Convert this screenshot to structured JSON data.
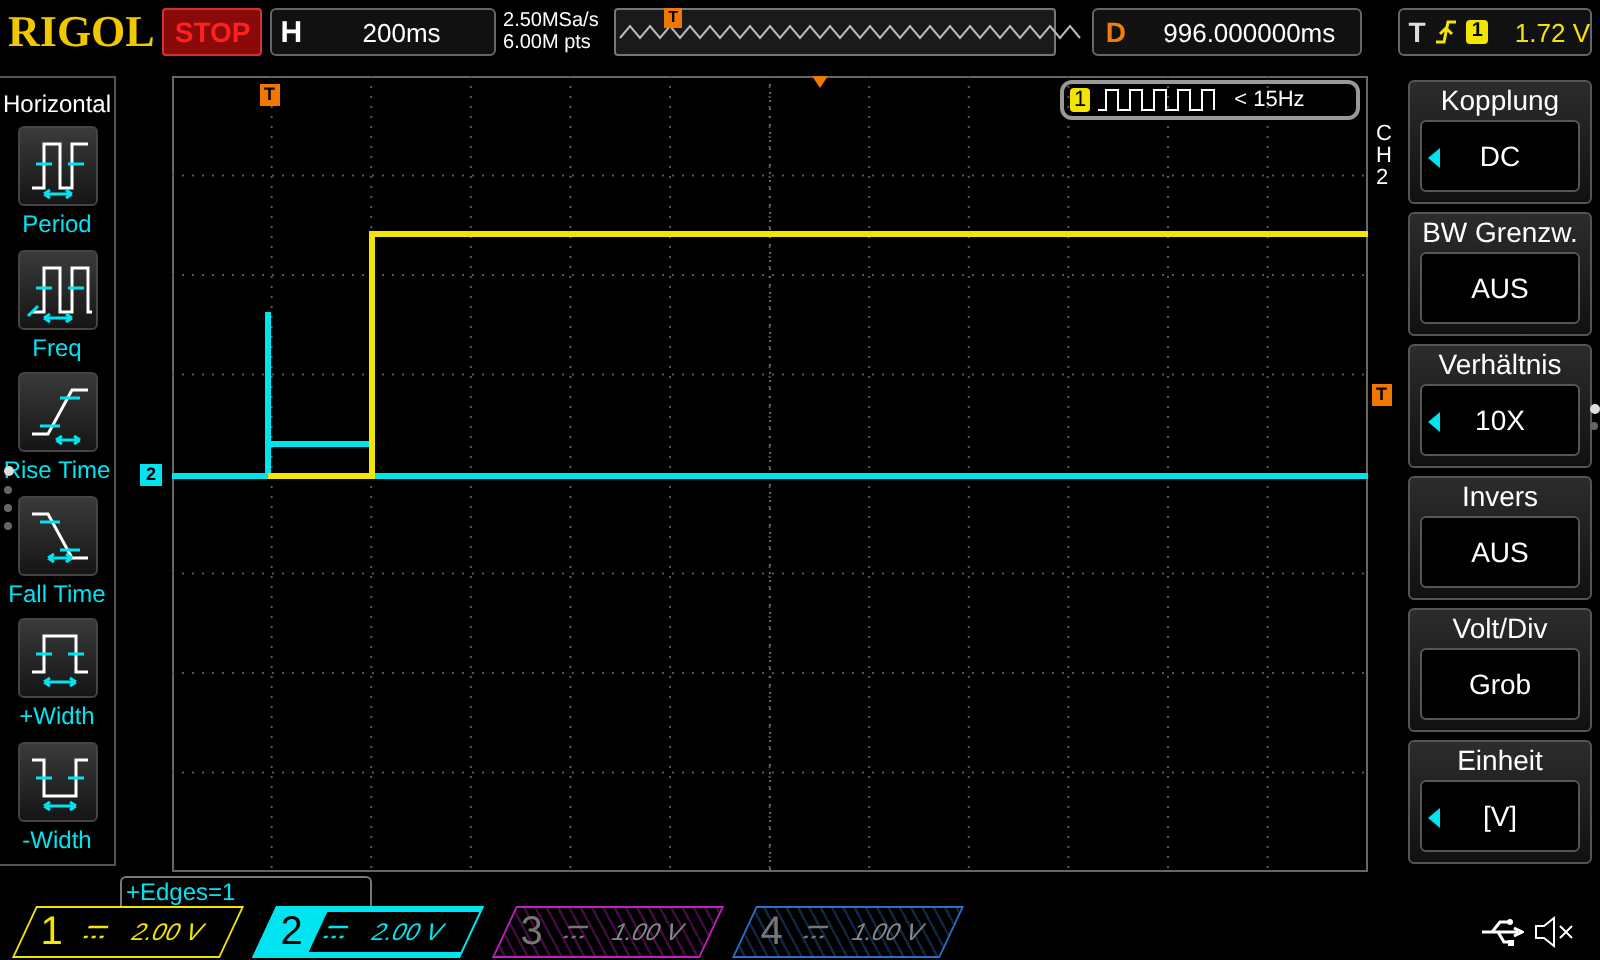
{
  "brand": "RIGOL",
  "run_state": "STOP",
  "horizontal": {
    "label": "H",
    "timebase": "200ms"
  },
  "acquisition": {
    "sample_rate": "2.50MSa/s",
    "memory_depth": "6.00M pts"
  },
  "overview": {
    "trigger_marker": "T"
  },
  "delay": {
    "label": "D",
    "value": "996.000000ms"
  },
  "trigger": {
    "label": "T",
    "source": "1",
    "level": "1.72 V"
  },
  "left_menu": {
    "title": "Horizontal",
    "items": [
      {
        "kind": "period",
        "label": "Period"
      },
      {
        "kind": "freq",
        "label": "Freq"
      },
      {
        "kind": "rise",
        "label": "Rise Time"
      },
      {
        "kind": "fall",
        "label": "Fall Time"
      },
      {
        "kind": "pwidth",
        "label": "+Width"
      },
      {
        "kind": "nwidth",
        "label": "-Width"
      }
    ],
    "pages": [
      {
        "selected": true
      },
      {
        "selected": false
      },
      {
        "selected": false
      },
      {
        "selected": false
      }
    ]
  },
  "plot": {
    "time_marker": "T",
    "channel_marker": "2",
    "trigger_level_marker": "T"
  },
  "frequency_counter": {
    "channel": "1",
    "reading": "< 15Hz"
  },
  "measurement": "+Edges=1",
  "right_menu": {
    "channel": "CH2",
    "items": [
      {
        "title": "Kopplung",
        "value": "DC",
        "adjustable": true
      },
      {
        "title": "BW Grenzw.",
        "value": "AUS",
        "adjustable": false
      },
      {
        "title": "Verhältnis",
        "value": "10X",
        "adjustable": true
      },
      {
        "title": "Invers",
        "value": "AUS",
        "adjustable": false
      },
      {
        "title": "Volt/Div",
        "value": "Grob",
        "adjustable": false
      },
      {
        "title": "Einheit",
        "value": "[V]",
        "adjustable": true
      }
    ],
    "pages": [
      {
        "selected": true
      },
      {
        "selected": false
      }
    ]
  },
  "channels": [
    {
      "number": "1",
      "scale": "2.00 V",
      "enabled": true,
      "selected": false,
      "color": "#f2e600"
    },
    {
      "number": "2",
      "scale": "2.00 V",
      "enabled": true,
      "selected": true,
      "color": "#00e4f0"
    },
    {
      "number": "3",
      "scale": "1.00 V",
      "enabled": false,
      "selected": false,
      "color": "#c020c0"
    },
    {
      "number": "4",
      "scale": "1.00 V",
      "enabled": false,
      "selected": false,
      "color": "#2a6fc8"
    }
  ]
}
